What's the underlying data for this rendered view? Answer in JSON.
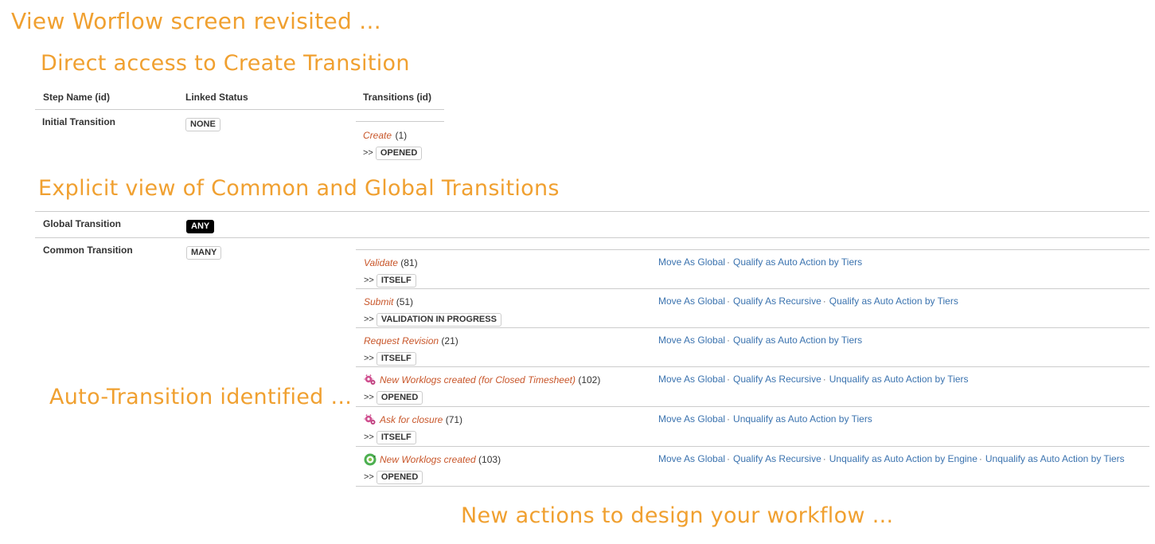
{
  "headings": {
    "main": "View Worflow screen revisited ...",
    "direct": "Direct access to Create Transition",
    "explicit": "Explicit view of Common and Global Transitions",
    "auto": "Auto-Transition identified ...",
    "new_actions": "New actions to design your workflow ..."
  },
  "table": {
    "columns": [
      "Step Name (id)",
      "Linked Status",
      "Transitions (id)"
    ],
    "initial": {
      "step": "Initial Transition",
      "status": "NONE",
      "transition": {
        "name": "Create",
        "id": "(1)",
        "target": "OPENED"
      }
    },
    "global": {
      "step": "Global Transition",
      "status": "ANY"
    },
    "common": {
      "step": "Common Transition",
      "status": "MANY"
    }
  },
  "arrow": ">>",
  "transitions": [
    {
      "name": "Validate",
      "id": "(81)",
      "target": "ITSELF",
      "icon": null,
      "actions": [
        "Move As Global",
        "Qualify as Auto Action by Tiers"
      ]
    },
    {
      "name": "Submit",
      "id": "(51)",
      "target": "VALIDATION IN PROGRESS",
      "icon": null,
      "actions": [
        "Move As Global",
        "Qualify As Recursive",
        "Qualify as Auto Action by Tiers"
      ]
    },
    {
      "name": "Request Revision",
      "id": "(21)",
      "target": "ITSELF",
      "icon": null,
      "actions": [
        "Move As Global",
        "Qualify as Auto Action by Tiers"
      ]
    },
    {
      "name": "New Worklogs created (for Closed Timesheet)",
      "id": "(102)",
      "target": "OPENED",
      "icon": "tiers-auto-icon",
      "actions": [
        "Move As Global",
        "Qualify As Recursive",
        "Unqualify as Auto Action by Tiers"
      ]
    },
    {
      "name": "Ask for closure",
      "id": "(71)",
      "target": "ITSELF",
      "icon": "tiers-auto-icon",
      "actions": [
        "Move As Global",
        "Unqualify as Auto Action by Tiers"
      ]
    },
    {
      "name": "New Worklogs created",
      "id": "(103)",
      "target": "OPENED",
      "icon": "engine-auto-icon",
      "actions": [
        "Move As Global",
        "Qualify As Recursive",
        "Unqualify as Auto Action by Engine",
        "Unqualify as Auto Action by Tiers"
      ]
    }
  ],
  "colors": {
    "heading": "#f0a030",
    "transition_name": "#c8562a",
    "action_link": "#3b73af",
    "divider": "#cccccc"
  }
}
